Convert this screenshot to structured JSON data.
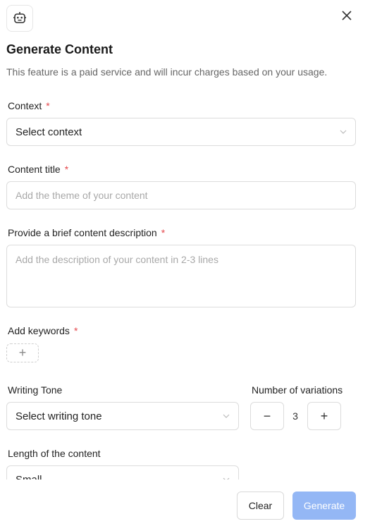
{
  "header": {
    "icon": "robot-icon",
    "close_icon": "close-icon",
    "title": "Generate Content",
    "subtitle": "This feature is a paid service and will incur charges based on your usage."
  },
  "form": {
    "context": {
      "label": "Context",
      "required": "*",
      "value": "Select context"
    },
    "content_title": {
      "label": "Content title",
      "required": "*",
      "placeholder": "Add the theme of your content"
    },
    "description": {
      "label": "Provide a brief content description",
      "required": "*",
      "placeholder": "Add the description of your content in 2-3 lines"
    },
    "keywords": {
      "label": "Add keywords",
      "required": "*",
      "add_symbol": "+"
    },
    "writing_tone": {
      "label": "Writing Tone",
      "value": "Select writing tone"
    },
    "variations": {
      "label": "Number of variations",
      "value": "3",
      "minus": "−",
      "plus": "+"
    },
    "length": {
      "label": "Length of the content",
      "value": "Small"
    }
  },
  "footer": {
    "clear_label": "Clear",
    "generate_label": "Generate"
  },
  "colors": {
    "required": "#e5484d",
    "primary_disabled": "#94b7f5"
  }
}
